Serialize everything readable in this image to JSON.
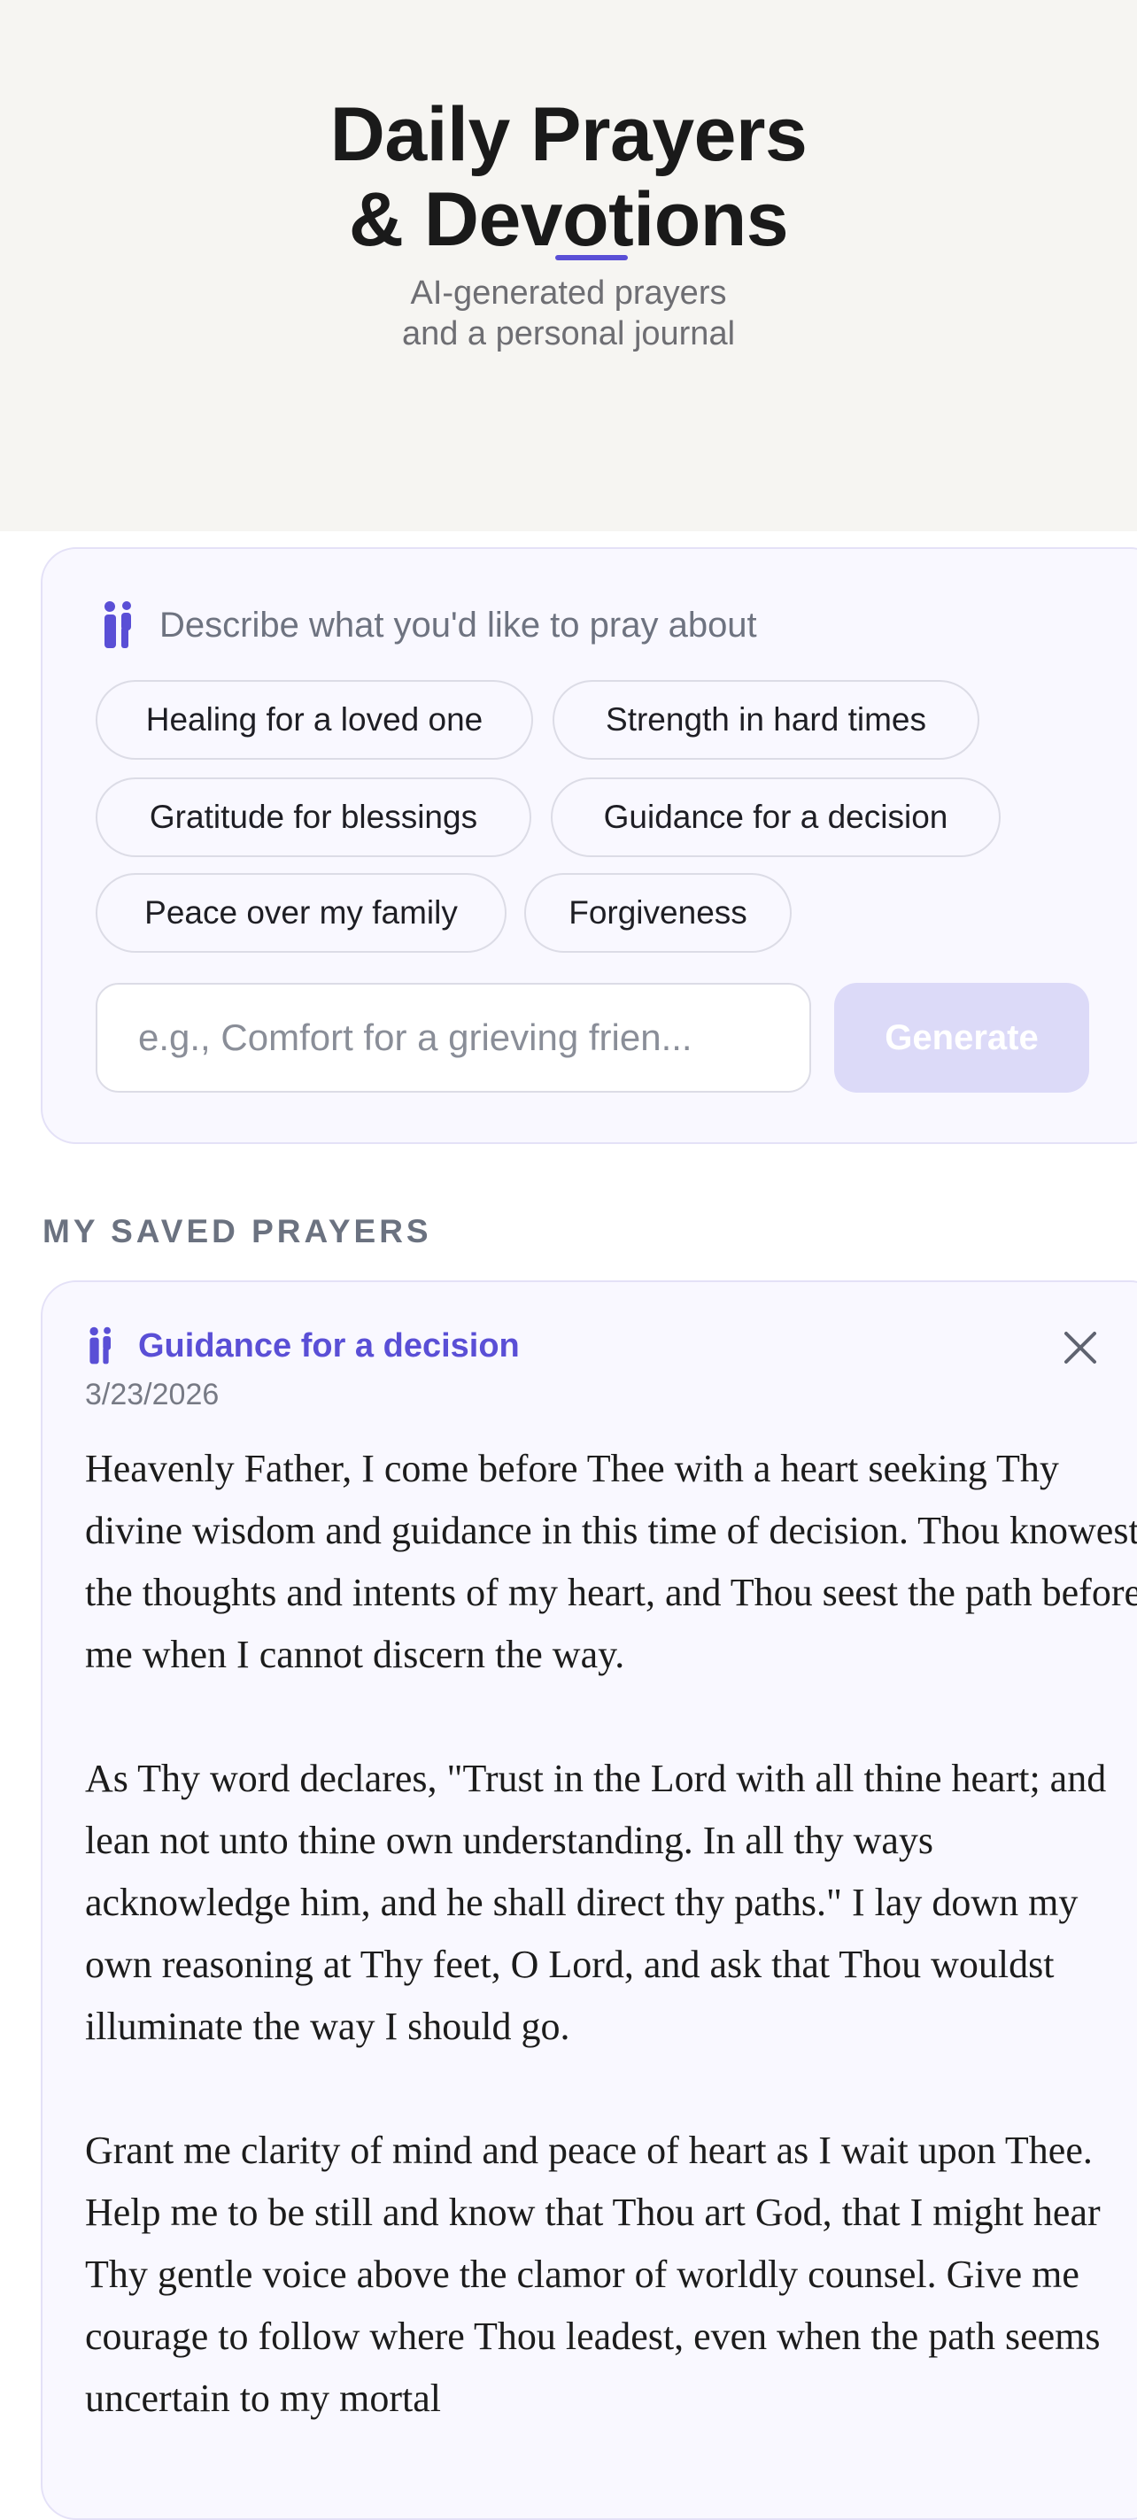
{
  "header": {
    "title_line1": "Daily Prayers",
    "title_line2": "& Devotions",
    "subtitle_line1": "AI-generated prayers",
    "subtitle_line2": "and a personal journal"
  },
  "composer": {
    "label": "Describe what you'd like to pray about",
    "icon": "praying-person-icon",
    "chips": [
      "Healing for a loved one",
      "Strength in hard times",
      "Gratitude for blessings",
      "Guidance for a decision",
      "Peace over my family",
      "Forgiveness"
    ],
    "input_placeholder": "e.g., Comfort for a grieving frien...",
    "generate_label": "Generate"
  },
  "saved": {
    "section_title": "MY SAVED PRAYERS",
    "items": [
      {
        "title": "Guidance for a decision",
        "date": "3/23/2026",
        "paragraphs": [
          "Heavenly Father, I come before Thee with a heart seeking Thy divine wisdom and guidance in this time of decision. Thou knowest the thoughts and intents of my heart, and Thou seest the path before me when I cannot discern the way.",
          "As Thy word declares, \"Trust in the Lord with all thine heart; and lean not unto thine own understanding. In all thy ways acknowledge him, and he shall direct thy paths.\" I lay down my own reasoning at Thy feet, O Lord, and ask that Thou wouldst illuminate the way I should go.",
          "Grant me clarity of mind and peace of heart as I wait upon Thee. Help me to be still and know that Thou art God, that I might hear Thy gentle voice above the clamor of worldly counsel. Give me courage to follow where Thou leadest, even when the path seems uncertain to my mortal"
        ]
      }
    ]
  },
  "colors": {
    "accent": "#5a4fd6",
    "hero_bg": "#f6f5f2",
    "card_bg": "#f9f8ff",
    "generate_disabled": "#dcdaf8"
  }
}
